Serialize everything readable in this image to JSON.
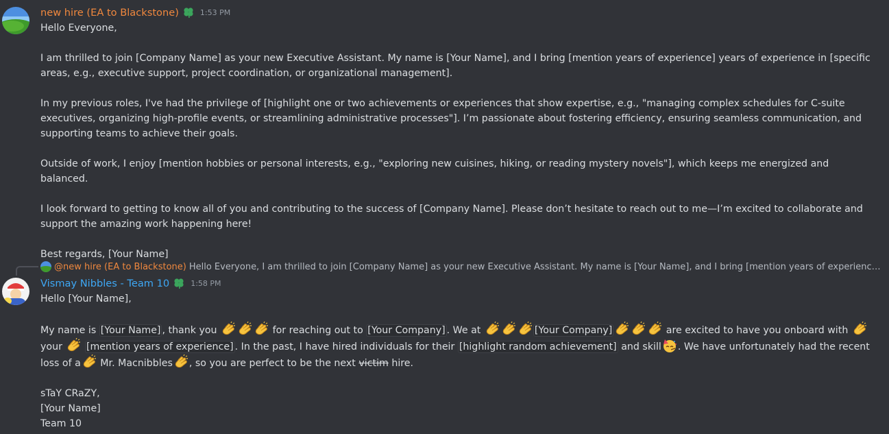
{
  "messages": [
    {
      "author": "new hire (EA to Blackstone)",
      "timestamp": "1:53 PM",
      "lines": [
        "Hello Everyone,",
        "",
        "I am thrilled to join [Company Name] as your new Executive Assistant. My name is [Your Name], and I bring [mention years of experience] years of experience in [specific areas, e.g., executive support, project coordination, or organizational management].",
        "",
        "In my previous roles, I've had the privilege of [highlight one or two achievements or experiences that show expertise, e.g., \"managing complex schedules for C-suite executives, organizing high-profile events, or streamlining administrative processes\"]. I’m passionate about fostering efficiency, ensuring seamless communication, and supporting teams to achieve their goals.",
        "",
        "Outside of work, I enjoy [mention hobbies or personal interests, e.g., \"exploring new cuisines, hiking, or reading mystery novels\"], which keeps me energized and balanced.",
        "",
        "I look forward to getting to know all of you and contributing to the success of [Company Name]. Please don’t hesitate to reach out to me—I’m excited to collaborate and support the amazing work happening here!",
        "",
        "Best regards, [Your Name]"
      ]
    },
    {
      "author": "Vismay Nibbles - Team 10",
      "timestamp": "1:58 PM",
      "reply": {
        "mention": "@new hire (EA to Blackstone)",
        "text": "Hello Everyone,  I am thrilled to join [Company Name] as your new Executive Assistant. My name is [Your Name], and I bring [mention years of experience] years of experience in [specific areas, e.g., executive support, project coordination, or organizational management]."
      },
      "greeting": "Hello [Your Name],",
      "para": {
        "t1": "My name is ",
        "c1": "[Your Name]",
        "t2": ", thank you",
        "t3": " for reaching out to ",
        "c2": "[Your Company]",
        "t4": ". We at",
        "c3": "[Your Company]",
        "t5": " are excited to have you onboard with",
        "t6": " your",
        "c4": "[mention years of experience]",
        "t7": ". In the past, I have hired individuals for their ",
        "c5": "[highlight random achievement]",
        "t8": " and skill",
        "t9": ". We have unfortunately had the recent loss of a",
        "t10": " Mr. Macnibbles",
        "t11": ", so you are perfect to be the next ",
        "strike": "victim",
        "t12": " hire."
      },
      "signoff": [
        "sTaY CRaZY,",
        "[Your Name]",
        "Team 10"
      ]
    }
  ],
  "icons": {
    "role_badge": "clover-icon",
    "clap": "clapping-hands-emoji",
    "party": "partying-face-emoji"
  },
  "colors": {
    "background": "#313338",
    "text": "#dbdee1",
    "author1": "#f0883e",
    "author2": "#3ea8f5",
    "timestamp": "#949ba4",
    "badge": "#3ba55c"
  }
}
